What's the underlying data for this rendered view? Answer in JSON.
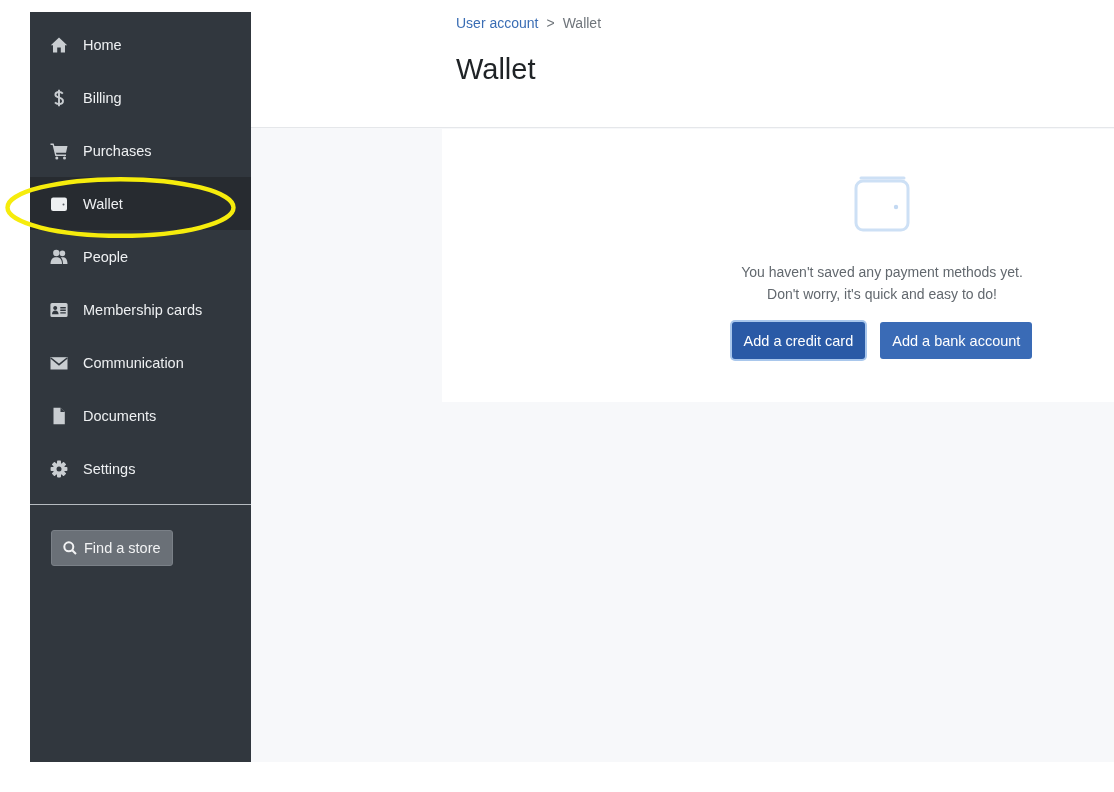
{
  "sidebar": {
    "items": [
      {
        "label": "Home",
        "selected": false,
        "highlighted": false
      },
      {
        "label": "Billing",
        "selected": false,
        "highlighted": false
      },
      {
        "label": "Purchases",
        "selected": false,
        "highlighted": false
      },
      {
        "label": "Wallet",
        "selected": true,
        "highlighted": true
      },
      {
        "label": "People",
        "selected": false,
        "highlighted": false
      },
      {
        "label": "Membership cards",
        "selected": false,
        "highlighted": false
      },
      {
        "label": "Communication",
        "selected": false,
        "highlighted": false
      },
      {
        "label": "Documents",
        "selected": false,
        "highlighted": false
      },
      {
        "label": "Settings",
        "selected": false,
        "highlighted": false
      }
    ],
    "find_store_button": {
      "label": "Find a store"
    }
  },
  "header": {
    "breadcrumb": [
      {
        "label": "User account",
        "kind": "link"
      },
      {
        "label": ">",
        "kind": "separator"
      },
      {
        "label": "Wallet",
        "kind": "current"
      }
    ],
    "title": "Wallet"
  },
  "empty_state": {
    "message": [
      "You haven't saved any payment methods yet.",
      "Don't worry, it's quick and easy to do!"
    ],
    "buttons": [
      {
        "label": "Add a credit card",
        "focused": true
      },
      {
        "label": "Add a bank account",
        "focused": false
      }
    ]
  }
}
